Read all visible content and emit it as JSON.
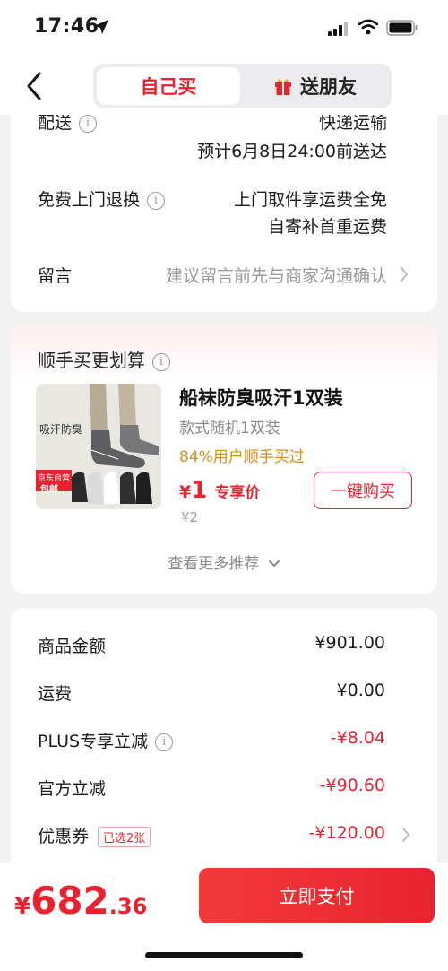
{
  "status_bar": {
    "time": "17:46"
  },
  "header": {
    "tab_self": "自己买",
    "tab_gift": "送朋友"
  },
  "delivery": {
    "label": "配送",
    "method": "快递运输",
    "eta": "预计6月8日24:00前送达"
  },
  "returns": {
    "label": "免费上门退换",
    "line1": "上门取件享运费全免",
    "line2": "自寄补首重运费"
  },
  "message": {
    "label": "留言",
    "placeholder": "建议留言前先与商家沟通确认"
  },
  "recommend": {
    "title": "顺手买更划算",
    "product": {
      "image_text": "吸汗防臭",
      "badge_top": "京东自营",
      "badge_bottom": "包邮",
      "name": "船袜防臭吸汗1双装",
      "spec": "款式随机1双装",
      "buy_rate": "84%用户顺手买过",
      "price_symbol": "¥",
      "price": "1",
      "price_tag": "专享价",
      "original_price": "¥2",
      "buy_button": "一键购买"
    },
    "more": "查看更多推荐"
  },
  "summary": {
    "items": [
      {
        "label": "商品金额",
        "value": "¥901.00"
      },
      {
        "label": "运费",
        "value": "¥0.00"
      },
      {
        "label": "PLUS专享立减",
        "value": "-¥8.04"
      },
      {
        "label": "官方立减",
        "value": "-¥90.60"
      },
      {
        "label": "优惠券",
        "badge": "已选2张",
        "value": "-¥120.00"
      }
    ]
  },
  "footer": {
    "total_symbol": "¥",
    "total_int": "682",
    "total_dec": ".36",
    "pay_button": "立即支付"
  },
  "colors": {
    "accent": "#e8232f",
    "orange": "#d98d1b"
  }
}
